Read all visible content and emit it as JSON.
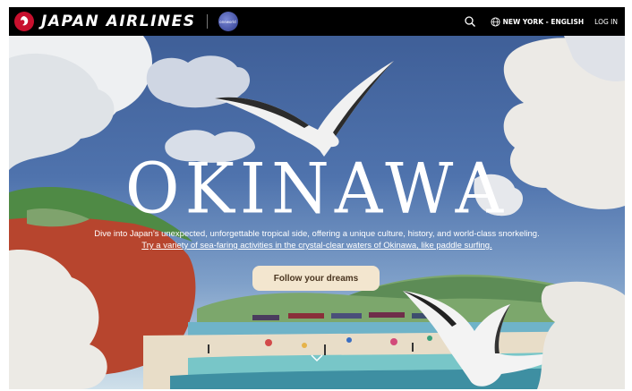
{
  "header": {
    "brand": "JAPAN AIRLINES",
    "alliance_label": "oneworld",
    "locale_label": "NEW YORK - ENGLISH",
    "login_label": "LOG IN"
  },
  "hero": {
    "title": "OKINAWA",
    "description_lead": "Dive into Japan’s unexpected, unforgettable tropical side, offering a unique culture, history, and world-class snorkeling.",
    "description_link": "Try a variety of sea-faring activities in the crystal-clear waters of Okinawa, like paddle surfing.",
    "cta_label": "Follow your dreams"
  },
  "colors": {
    "brand_red": "#c8102e",
    "nav_bg": "#000000",
    "cta_bg": "#f3e6cf"
  }
}
